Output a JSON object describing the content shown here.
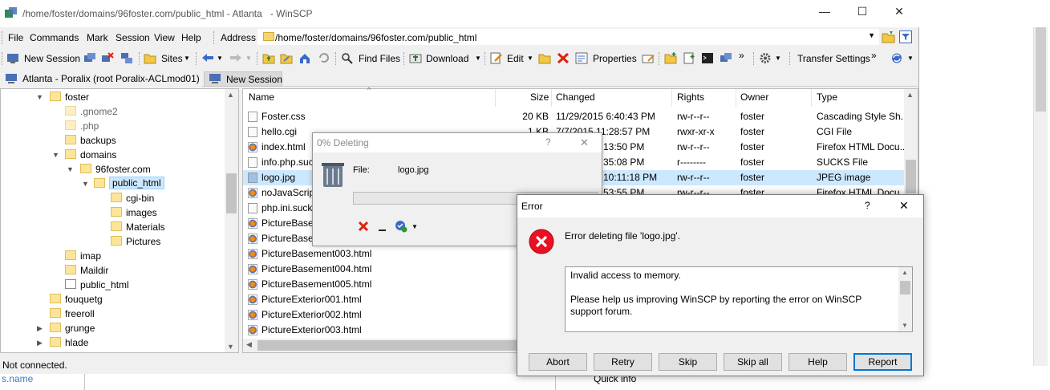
{
  "window": {
    "title": "/home/foster/domains/96foster.com/public_html - Atlanta   - WinSCP",
    "caption_minimize": "—",
    "caption_maximize": "☐",
    "caption_close": "✕"
  },
  "menu": {
    "items": [
      "File",
      "Commands",
      "Mark",
      "Session",
      "View",
      "Help"
    ],
    "address_label": "Address",
    "address_value": "/home/foster/domains/96foster.com/public_html"
  },
  "toolbar": {
    "new_session": "New Session",
    "sites": "Sites",
    "find_files": "Find Files",
    "download": "Download",
    "edit": "Edit",
    "properties": "Properties",
    "transfer_settings": "Transfer Settings",
    "more": "»"
  },
  "session_tabs": {
    "active": "Atlanta - Poralix (root Poralix-ACLmod01)",
    "new": "New Session"
  },
  "tree": {
    "items": [
      {
        "label": "foster"
      },
      {
        "label": ".gnome2"
      },
      {
        "label": ".php"
      },
      {
        "label": "backups"
      },
      {
        "label": "domains"
      },
      {
        "label": "96foster.com"
      },
      {
        "label": "public_html"
      },
      {
        "label": "cgi-bin"
      },
      {
        "label": "images"
      },
      {
        "label": "Materials"
      },
      {
        "label": "Pictures"
      },
      {
        "label": "imap"
      },
      {
        "label": "Maildir"
      },
      {
        "label": "public_html"
      },
      {
        "label": "fouquetg"
      },
      {
        "label": "freeroll"
      },
      {
        "label": "grunge"
      },
      {
        "label": "hlade"
      }
    ]
  },
  "files": {
    "columns": [
      "Name",
      "Size",
      "Changed",
      "Rights",
      "Owner",
      "Type"
    ],
    "rows": [
      {
        "name": "Foster.css",
        "size": "20 KB",
        "changed": "11/29/2015 6:40:43 PM",
        "rights": "rw-r--r--",
        "owner": "foster",
        "type": "Cascading Style Sh..."
      },
      {
        "name": "hello.cgi",
        "size": "1 KB",
        "changed": "7/7/2015 11:28:57 PM",
        "rights": "rwxr-xr-x",
        "owner": "foster",
        "type": "CGI File"
      },
      {
        "name": "index.html",
        "size": "",
        "changed": "13:50 PM",
        "rights": "rw-r--r--",
        "owner": "foster",
        "type": "Firefox HTML Docu..."
      },
      {
        "name": "info.php.suck",
        "size": "",
        "changed": "35:08 PM",
        "rights": "r--------",
        "owner": "foster",
        "type": "SUCKS File"
      },
      {
        "name": "logo.jpg",
        "size": "",
        "changed": "10:11:18 PM",
        "rights": "rw-r--r--",
        "owner": "foster",
        "type": "JPEG image"
      },
      {
        "name": "noJavaScript",
        "size": "",
        "changed": "53:55 PM",
        "rights": "rw-r--r--",
        "owner": "foster",
        "type": "Firefox HTML Docu..."
      },
      {
        "name": "php.ini.sucks",
        "size": "",
        "changed": "",
        "rights": "",
        "owner": "",
        "type": ""
      },
      {
        "name": "PictureBasement",
        "size": "",
        "changed": "",
        "rights": "",
        "owner": "",
        "type": ""
      },
      {
        "name": "PictureBasem",
        "size": "",
        "changed": "",
        "rights": "",
        "owner": "",
        "type": ""
      },
      {
        "name": "PictureBasement003.html",
        "size": "",
        "changed": "",
        "rights": "",
        "owner": "",
        "type": ""
      },
      {
        "name": "PictureBasement004.html",
        "size": "",
        "changed": "",
        "rights": "",
        "owner": "",
        "type": ""
      },
      {
        "name": "PictureBasement005.html",
        "size": "",
        "changed": "",
        "rights": "",
        "owner": "",
        "type": ""
      },
      {
        "name": "PictureExterior001.html",
        "size": "",
        "changed": "",
        "rights": "",
        "owner": "",
        "type": ""
      },
      {
        "name": "PictureExterior002.html",
        "size": "",
        "changed": "",
        "rights": "",
        "owner": "",
        "type": ""
      },
      {
        "name": "PictureExterior003.html",
        "size": "",
        "changed": "",
        "rights": "",
        "owner": "",
        "type": ""
      }
    ]
  },
  "status": {
    "text": "Not connected."
  },
  "background": {
    "left_text": "s.name",
    "quick_info": "Quick info"
  },
  "deleting_dialog": {
    "title": "0% Deleting",
    "help": "?",
    "close": "✕",
    "file_label": "File:",
    "file_value": "logo.jpg",
    "progress": 0
  },
  "error_dialog": {
    "title": "Error",
    "help": "?",
    "close": "✕",
    "message": "Error deleting file 'logo.jpg'.",
    "details_line1": "Invalid access to memory.",
    "details_line2": "Please help us improving WinSCP by reporting the error on WinSCP support forum.",
    "buttons": [
      "Abort",
      "Retry",
      "Skip",
      "Skip all",
      "Help",
      "Report"
    ],
    "default_button": "Report"
  }
}
